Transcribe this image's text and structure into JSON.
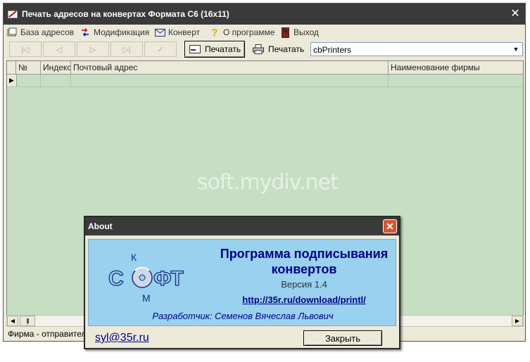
{
  "window": {
    "title": "Печать адресов на конвертах Формата С6 (16x11)",
    "close_glyph": "✕"
  },
  "menu": [
    {
      "label": "База адресов",
      "icon": "database-icon"
    },
    {
      "label": "Модификация",
      "icon": "modify-icon"
    },
    {
      "label": "Конверт",
      "icon": "envelope-icon"
    },
    {
      "label": "О программе",
      "icon": "help-icon"
    },
    {
      "label": "Выход",
      "icon": "exit-icon"
    }
  ],
  "toolbar": {
    "nav": [
      "|◁",
      "◁",
      "▷",
      "▷|",
      "✓"
    ],
    "print1": "Печатать",
    "print2": "Печатать",
    "printer_combo": "cbPrinters"
  },
  "grid": {
    "columns": [
      "№",
      "Индекс",
      "Почтовый адрес",
      "Наименование фирмы"
    ],
    "row_indicator": "▶"
  },
  "watermark": "soft.mydiv.net",
  "status": "Фирма - отправитель",
  "about": {
    "title": "About",
    "close_glyph": "✕",
    "product_line1": "Программа подписывания",
    "product_line2": "конвертов",
    "version": "Версия 1.4",
    "link": "http://35r.ru/download/printl/",
    "developer": "Разработчик: Семенов Вячеслав Львович",
    "email": "syl@35r.ru",
    "close_button": "Закрыть",
    "logo_text": {
      "left": "С",
      "right": "ФТ",
      "top": "К",
      "bottom": "М"
    }
  },
  "colors": {
    "grid_bg": "#c6dfc2",
    "about_panel": "#99d1ee",
    "accent_text": "#00008b",
    "titlebar": "#3a3a3a",
    "close_red": "#d8542f"
  }
}
